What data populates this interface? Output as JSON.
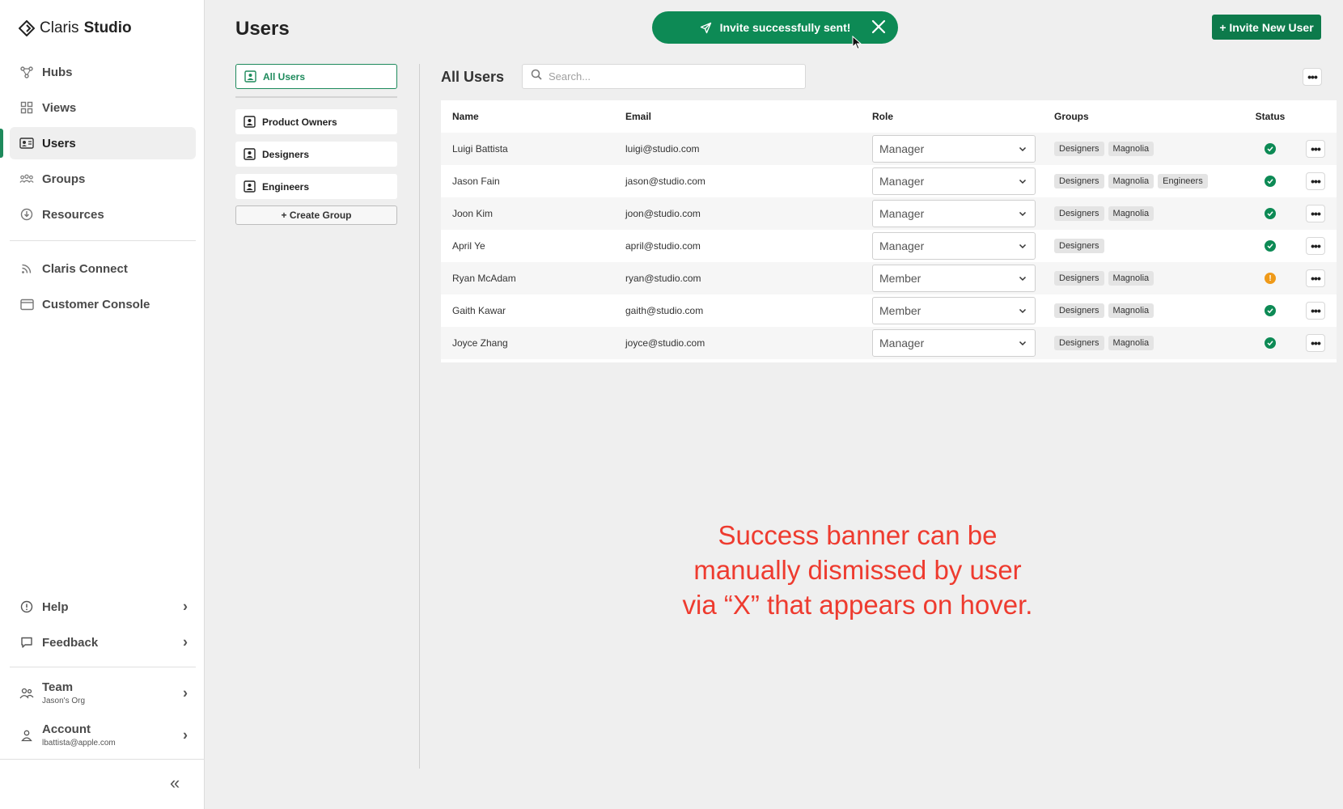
{
  "brand": {
    "name_light": "Claris",
    "name_bold": "Studio"
  },
  "sidebar": {
    "items": [
      {
        "label": "Hubs",
        "icon": "hubs-icon"
      },
      {
        "label": "Views",
        "icon": "views-icon"
      },
      {
        "label": "Users",
        "icon": "users-icon",
        "active": true
      },
      {
        "label": "Groups",
        "icon": "groups-icon"
      },
      {
        "label": "Resources",
        "icon": "resources-icon"
      }
    ],
    "secondary": [
      {
        "label": "Claris Connect",
        "icon": "rss-icon"
      },
      {
        "label": "Customer Console",
        "icon": "window-icon"
      }
    ],
    "bottom": {
      "help": "Help",
      "feedback": "Feedback",
      "team": {
        "label": "Team",
        "sub": "Jason's Org"
      },
      "account": {
        "label": "Account",
        "sub": "lbattista@apple.com"
      }
    }
  },
  "header": {
    "title": "Users",
    "invite_button": "+ Invite New User"
  },
  "toast": {
    "message": "Invite successfully sent!"
  },
  "groups_panel": {
    "all_users": "All Users",
    "groups": [
      "Product Owners",
      "Designers",
      "Engineers"
    ],
    "create_group": "+ Create Group"
  },
  "table": {
    "section_title": "All Users",
    "search_placeholder": "Search...",
    "headers": {
      "name": "Name",
      "email": "Email",
      "role": "Role",
      "groups": "Groups",
      "status": "Status"
    },
    "rows": [
      {
        "name": "Luigi Battista",
        "email": "luigi@studio.com",
        "role": "Manager",
        "groups": [
          "Designers",
          "Magnolia"
        ],
        "status": "ok"
      },
      {
        "name": "Jason Fain",
        "email": "jason@studio.com",
        "role": "Manager",
        "groups": [
          "Designers",
          "Magnolia",
          "Engineers"
        ],
        "status": "ok"
      },
      {
        "name": "Joon Kim",
        "email": "joon@studio.com",
        "role": "Manager",
        "groups": [
          "Designers",
          "Magnolia"
        ],
        "status": "ok"
      },
      {
        "name": "April Ye",
        "email": "april@studio.com",
        "role": "Manager",
        "groups": [
          "Designers"
        ],
        "status": "ok"
      },
      {
        "name": "Ryan McAdam",
        "email": "ryan@studio.com",
        "role": "Member",
        "groups": [
          "Designers",
          "Magnolia"
        ],
        "status": "warning"
      },
      {
        "name": "Gaith Kawar",
        "email": "gaith@studio.com",
        "role": "Member",
        "groups": [
          "Designers",
          "Magnolia"
        ],
        "status": "ok"
      },
      {
        "name": "Joyce Zhang",
        "email": "joyce@studio.com",
        "role": "Manager",
        "groups": [
          "Designers",
          "Magnolia"
        ],
        "status": "ok"
      }
    ]
  },
  "annotation": {
    "lines": [
      "Success banner can be",
      "manually dismissed by user",
      "via “X” that appears on hover."
    ]
  },
  "colors": {
    "accent": "#0d8a55",
    "warning": "#ef9a19",
    "annotation": "#ee3b2f"
  }
}
